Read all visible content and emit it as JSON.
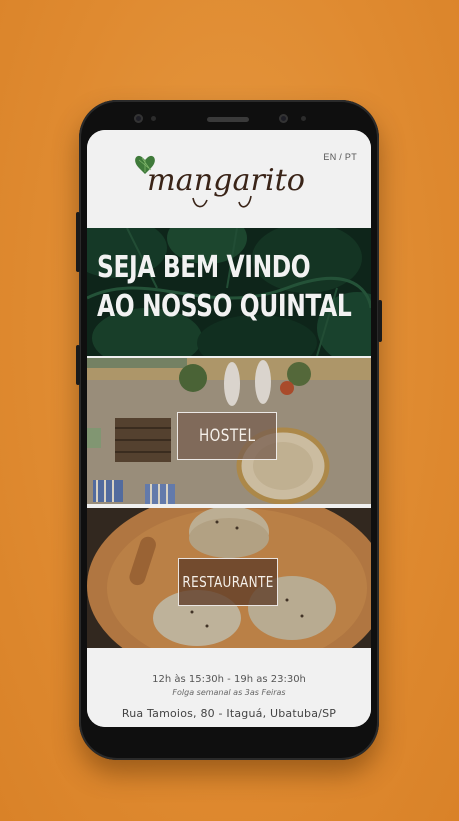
{
  "header": {
    "logo_text": "mangarito",
    "language_switch": "EN / PT"
  },
  "hero": {
    "line1": "SEJA BEM VINDO",
    "line2": "AO NOSSO QUINTAL"
  },
  "sections": {
    "hostel_label": "HOSTEL",
    "restaurant_label": "RESTAURANTE"
  },
  "footer": {
    "hours": "12h às 15:30h - 19h as 23:30h",
    "closed_day": "Folga semanal as 3as Feiras",
    "address": "Rua Tamoios, 80 - Itaguá, Ubatuba/SP"
  },
  "colors": {
    "background": "#df8a30",
    "hero_green": "#123022",
    "button_brown": "#785f50"
  }
}
